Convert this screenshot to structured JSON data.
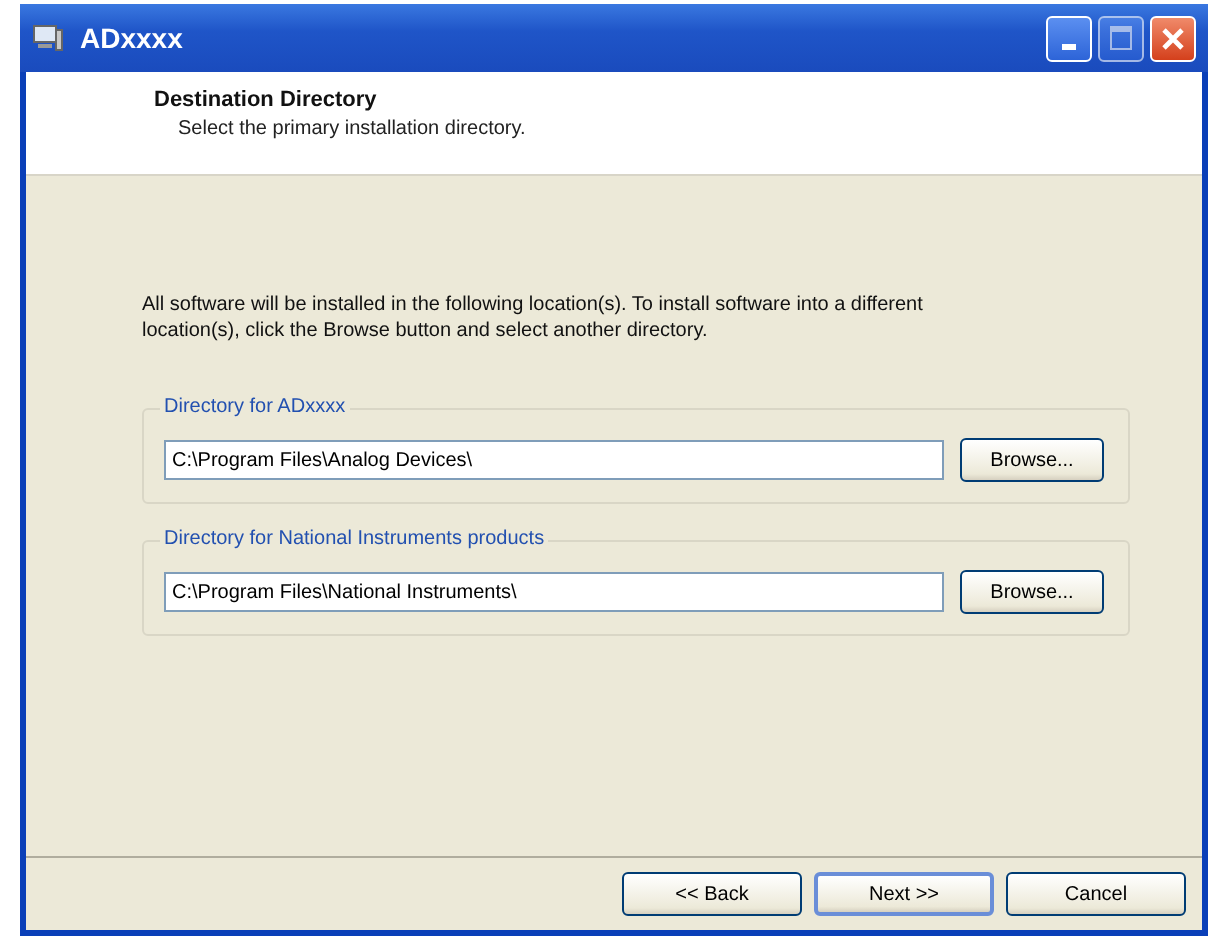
{
  "window": {
    "title": "ADxxxx"
  },
  "header": {
    "title": "Destination Directory",
    "subtitle": "Select the primary installation directory."
  },
  "description": "All software will be installed in the following location(s). To install software into a different location(s), click the Browse button and select another directory.",
  "groups": [
    {
      "label": "Directory for ADxxxx",
      "value": "C:\\Program Files\\Analog Devices\\",
      "button": "Browse..."
    },
    {
      "label": "Directory for National Instruments products",
      "value": "C:\\Program Files\\National Instruments\\",
      "button": "Browse..."
    }
  ],
  "buttons": [
    {
      "label": "<< Back",
      "default": false
    },
    {
      "label": "Next >>",
      "default": true
    },
    {
      "label": "Cancel",
      "default": false
    }
  ]
}
